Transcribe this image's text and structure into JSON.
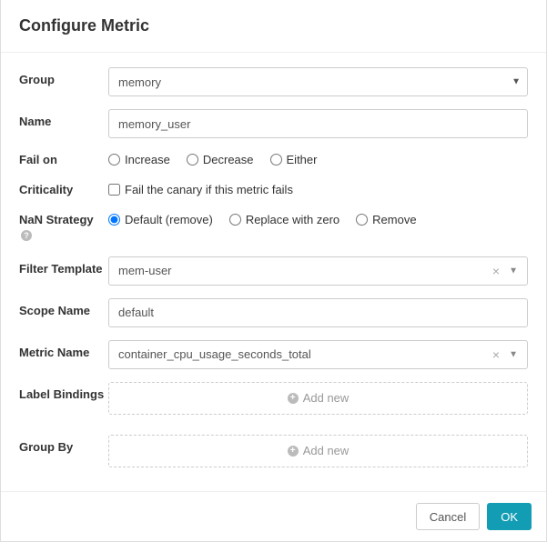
{
  "header": {
    "title": "Configure Metric"
  },
  "labels": {
    "group": "Group",
    "name": "Name",
    "failOn": "Fail on",
    "criticality": "Criticality",
    "nanStrategy": "NaN Strategy",
    "filterTemplate": "Filter Template",
    "scopeName": "Scope Name",
    "metricName": "Metric Name",
    "labelBindings": "Label Bindings",
    "groupBy": "Group By"
  },
  "values": {
    "group": "memory",
    "name": "memory_user",
    "filterTemplate": "mem-user",
    "scopeName": "default",
    "metricName": "container_cpu_usage_seconds_total"
  },
  "failOn": {
    "increase": "Increase",
    "decrease": "Decrease",
    "either": "Either",
    "selected": ""
  },
  "criticality": {
    "label": "Fail the canary if this metric fails",
    "checked": false
  },
  "nanStrategy": {
    "default": "Default (remove)",
    "replace": "Replace with zero",
    "remove": "Remove",
    "selected": "default"
  },
  "addNew": "Add new",
  "footer": {
    "cancel": "Cancel",
    "ok": "OK"
  }
}
